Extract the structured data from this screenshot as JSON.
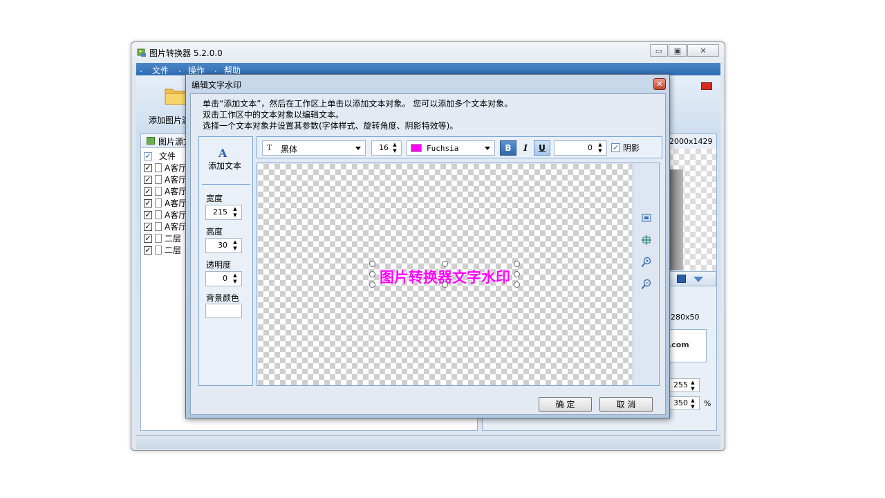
{
  "main_window": {
    "title": "图片转换器 5.2.0.0",
    "menu": [
      "文件",
      "操作",
      "帮助"
    ],
    "toolbar_add_label": "添加图片源",
    "left_panel": {
      "header": "图片源文件",
      "column_file": "文件",
      "rows": [
        "A客厅",
        "A客厅",
        "A客厅",
        "A客厅",
        "A客厅",
        "A客厅",
        "二层",
        "二层"
      ]
    },
    "right_panel": {
      "image_size": "2000x1429",
      "wm_size": "280x50",
      "logo_text": ".com",
      "value_a": "255",
      "value_b": "350",
      "percent": "%"
    }
  },
  "dialog": {
    "title": "编辑文字水印",
    "close": "✕",
    "hints": [
      "单击“添加文本”，然后在工作区上单击以添加文本对象。 您可以添加多个文本对象。",
      "双击工作区中的文本对象以编辑文本。",
      "选择一个文本对象并设置其参数(字体样式、旋转角度、阴影特效等)。"
    ],
    "side": {
      "add_text_icon": "A",
      "add_text_label": "添加文本",
      "width_label": "宽度",
      "width_value": "215",
      "height_label": "高度",
      "height_value": "30",
      "opacity_label": "透明度",
      "opacity_value": "0",
      "bg_color_label": "背景颜色"
    },
    "toolbar": {
      "font_icon": "T",
      "font": "黑体",
      "size": "16",
      "color_name": "Fuchsia",
      "color_hex": "#ff00ff",
      "bold": "B",
      "italic": "I",
      "underline": "U",
      "rotation": "0",
      "shadow_label": "阴影",
      "shadow_checked": true
    },
    "canvas": {
      "watermark_text": "图片转换器文字水印"
    },
    "ok_label": "确 定",
    "cancel_label": "取 消"
  }
}
